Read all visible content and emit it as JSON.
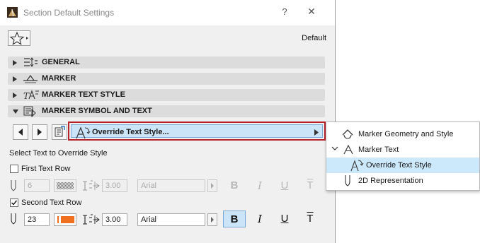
{
  "window": {
    "title": "Section Default Settings",
    "help": "?",
    "close": "✕"
  },
  "favorites": {
    "default_label": "Default"
  },
  "sections": [
    {
      "label": "GENERAL",
      "expanded": false
    },
    {
      "label": "MARKER",
      "expanded": false
    },
    {
      "label": "MARKER TEXT STYLE",
      "expanded": false
    },
    {
      "label": "MARKER SYMBOL AND TEXT",
      "expanded": true
    }
  ],
  "dropdown": {
    "label": "Override Text Style..."
  },
  "panel": {
    "select_label": "Select Text to Override Style",
    "first_row": {
      "label": "First Text Row",
      "checked": false,
      "size": "6",
      "width": "3.00",
      "font": "Arial"
    },
    "second_row": {
      "label": "Second Text Row",
      "checked": true,
      "size": "23",
      "width": "3.00",
      "font": "Arial",
      "pen_color": "#f07020"
    }
  },
  "style_glyphs": {
    "bold": "B",
    "italic": "I",
    "underline": "U",
    "strike": "T"
  },
  "popup": {
    "items": [
      {
        "label": "Marker Geometry and Style"
      },
      {
        "label": "Marker Text"
      },
      {
        "label": "Override Text Style",
        "selected": true
      },
      {
        "label": "2D Representation"
      }
    ]
  },
  "colors": {
    "highlight_border": "#b5232a",
    "selected_bg": "#cce4f7"
  }
}
